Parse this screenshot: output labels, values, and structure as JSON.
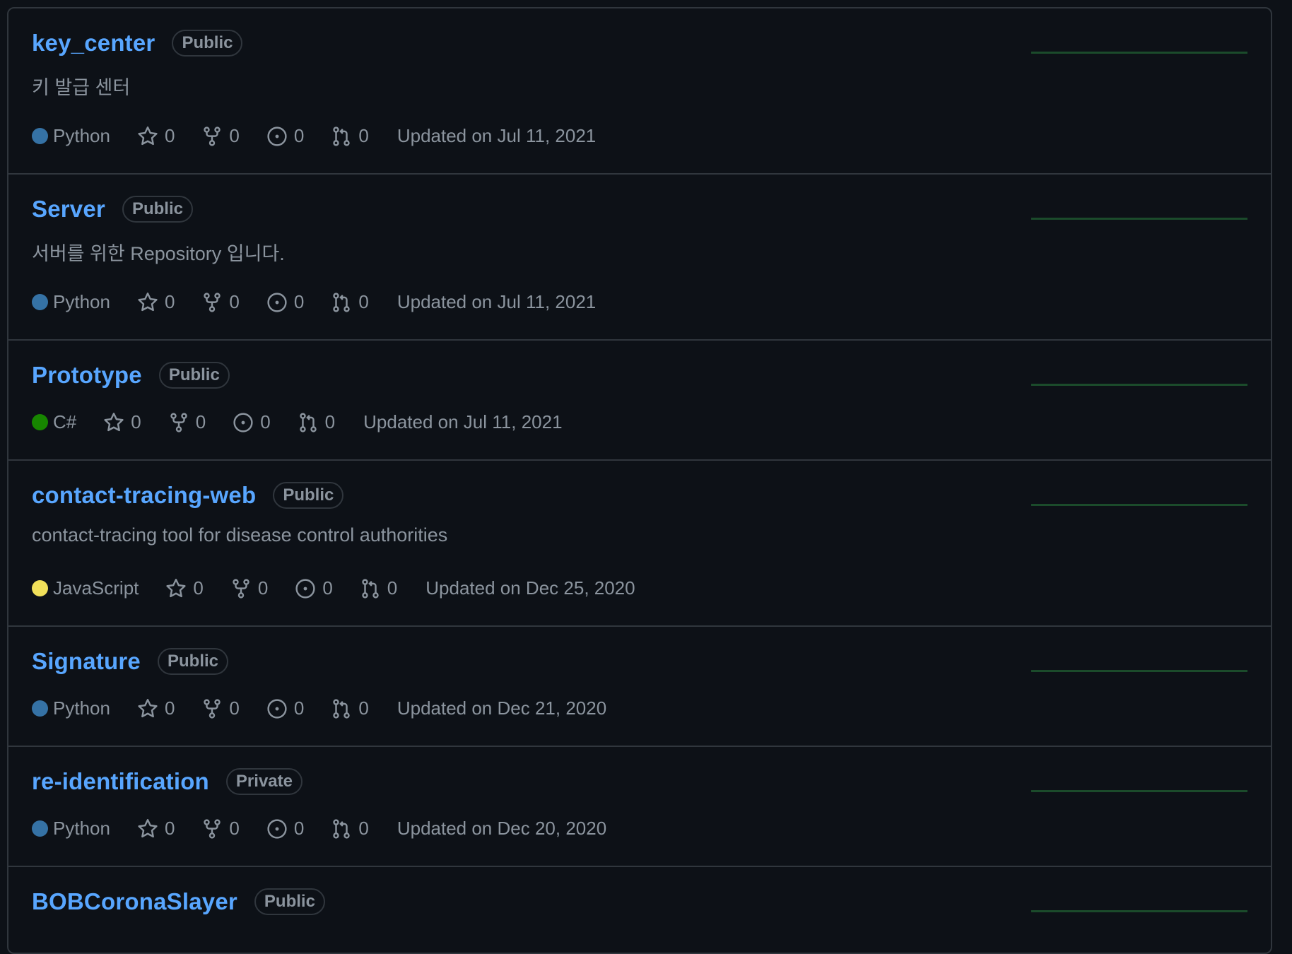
{
  "repos": [
    {
      "name": "key_center",
      "visibility": "Public",
      "description": "키 발급 센터",
      "language": "Python",
      "language_color": "#3572A5",
      "stars": "0",
      "forks": "0",
      "issues": "0",
      "pulls": "0",
      "updated": "Updated on Jul 11, 2021"
    },
    {
      "name": "Server",
      "visibility": "Public",
      "description": "서버를 위한 Repository 입니다.",
      "language": "Python",
      "language_color": "#3572A5",
      "stars": "0",
      "forks": "0",
      "issues": "0",
      "pulls": "0",
      "updated": "Updated on Jul 11, 2021"
    },
    {
      "name": "Prototype",
      "visibility": "Public",
      "description": "",
      "language": "C#",
      "language_color": "#178600",
      "stars": "0",
      "forks": "0",
      "issues": "0",
      "pulls": "0",
      "updated": "Updated on Jul 11, 2021"
    },
    {
      "name": "contact-tracing-web",
      "visibility": "Public",
      "description": "contact-tracing tool for disease control authorities",
      "language": "JavaScript",
      "language_color": "#f1e05a",
      "stars": "0",
      "forks": "0",
      "issues": "0",
      "pulls": "0",
      "updated": "Updated on Dec 25, 2020"
    },
    {
      "name": "Signature",
      "visibility": "Public",
      "description": "",
      "language": "Python",
      "language_color": "#3572A5",
      "stars": "0",
      "forks": "0",
      "issues": "0",
      "pulls": "0",
      "updated": "Updated on Dec 21, 2020"
    },
    {
      "name": "re-identification",
      "visibility": "Private",
      "description": "",
      "language": "Python",
      "language_color": "#3572A5",
      "stars": "0",
      "forks": "0",
      "issues": "0",
      "pulls": "0",
      "updated": "Updated on Dec 20, 2020"
    },
    {
      "name": "BOBCoronaSlayer",
      "visibility": "Public",
      "description": "",
      "language": "",
      "language_color": "",
      "stars": "",
      "forks": "",
      "issues": "",
      "pulls": "",
      "updated": ""
    }
  ],
  "icons": {
    "star": "star-icon",
    "fork": "repo-forked-icon",
    "issue": "issue-opened-icon",
    "pull": "git-pull-request-icon"
  },
  "colors": {
    "background": "#0d1117",
    "border": "#30363d",
    "link": "#58a6ff",
    "muted": "#8b949e",
    "activity": "#1b4b2b"
  }
}
